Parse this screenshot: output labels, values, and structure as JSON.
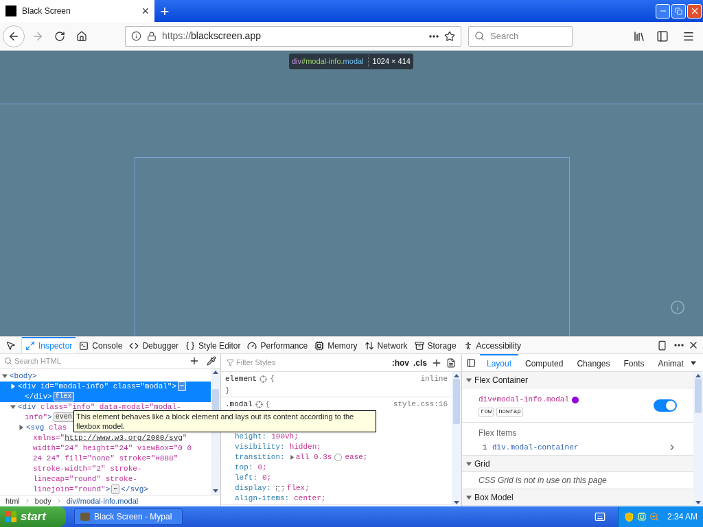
{
  "browser": {
    "tab": {
      "title": "Black Screen",
      "close": "×"
    },
    "new_tab": "+",
    "back_disabled": false,
    "forward_disabled": true,
    "url": {
      "scheme": "https://",
      "host": "blackscreen.app"
    },
    "search": {
      "placeholder": "Search"
    }
  },
  "page": {
    "highlight_label": {
      "tag": "div",
      "id": "#modal-info",
      "cls": ".modal",
      "size": "1024 × 414"
    }
  },
  "devtools": {
    "tabs": [
      {
        "label": "Inspector",
        "selected": true
      },
      {
        "label": "Console",
        "selected": false
      },
      {
        "label": "Debugger",
        "selected": false
      },
      {
        "label": "Style Editor",
        "selected": false
      },
      {
        "label": "Performance",
        "selected": false
      },
      {
        "label": "Memory",
        "selected": false
      },
      {
        "label": "Network",
        "selected": false
      },
      {
        "label": "Storage",
        "selected": false
      },
      {
        "label": "Accessibility",
        "selected": false
      }
    ],
    "markup": {
      "search_placeholder": "Search HTML",
      "nodes": [
        {
          "expanded": true,
          "selected": false,
          "lines": [
            [
              {
                "kind": "tag",
                "text": "<body>"
              }
            ]
          ],
          "children": [
            {
              "expanded": false,
              "selected": true,
              "lines": [
                [
                  {
                    "kind": "tag",
                    "text": "<div "
                  },
                  {
                    "kind": "attr",
                    "text": "id="
                  },
                  {
                    "kind": "val",
                    "text": "\"modal-info\" "
                  },
                  {
                    "kind": "attr",
                    "text": "class="
                  },
                  {
                    "kind": "val",
                    "text": "\"modal\""
                  },
                  {
                    "kind": "tag",
                    "text": ">"
                  },
                  {
                    "kind": "badge",
                    "text": "⋯"
                  }
                ],
                [
                  {
                    "kind": "tag",
                    "text": "</div>"
                  },
                  {
                    "kind": "badge",
                    "text": "flex"
                  }
                ]
              ]
            },
            {
              "expanded": true,
              "selected": false,
              "lines": [
                [
                  {
                    "kind": "tag",
                    "text": "<div "
                  },
                  {
                    "kind": "attr",
                    "text": "class="
                  },
                  {
                    "kind": "val",
                    "text": "\"info\" "
                  },
                  {
                    "kind": "attr",
                    "text": "data-modal="
                  },
                  {
                    "kind": "val",
                    "text": "\"modal-"
                  }
                ],
                [
                  {
                    "kind": "val",
                    "text": "info\""
                  },
                  {
                    "kind": "tag",
                    "text": ">"
                  },
                  {
                    "kind": "badge",
                    "text": "even"
                  }
                ]
              ],
              "children": [
                {
                  "expanded": false,
                  "selected": false,
                  "lines": [
                    [
                      {
                        "kind": "tag",
                        "text": "<svg "
                      },
                      {
                        "kind": "attr",
                        "text": "clas"
                      }
                    ],
                    [
                      {
                        "kind": "attr",
                        "text": "xmlns="
                      },
                      {
                        "kind": "val",
                        "text": "\""
                      },
                      {
                        "kind": "link",
                        "text": "http://www.w3.org/2000/svg"
                      },
                      {
                        "kind": "val",
                        "text": "\""
                      }
                    ],
                    [
                      {
                        "kind": "attr",
                        "text": "width="
                      },
                      {
                        "kind": "val",
                        "text": "\"24\" "
                      },
                      {
                        "kind": "attr",
                        "text": "height="
                      },
                      {
                        "kind": "val",
                        "text": "\"24\" "
                      },
                      {
                        "kind": "attr",
                        "text": "viewBox="
                      },
                      {
                        "kind": "val",
                        "text": "\"0 0"
                      }
                    ],
                    [
                      {
                        "kind": "val",
                        "text": "24 24\" "
                      },
                      {
                        "kind": "attr",
                        "text": "fill="
                      },
                      {
                        "kind": "val",
                        "text": "\"none\" "
                      },
                      {
                        "kind": "attr",
                        "text": "stroke="
                      },
                      {
                        "kind": "val",
                        "text": "\"#888\""
                      }
                    ],
                    [
                      {
                        "kind": "attr",
                        "text": "stroke-width="
                      },
                      {
                        "kind": "val",
                        "text": "\"2\" "
                      },
                      {
                        "kind": "attr",
                        "text": "stroke-"
                      }
                    ],
                    [
                      {
                        "kind": "attr",
                        "text": "linecap="
                      },
                      {
                        "kind": "val",
                        "text": "\"round\" "
                      },
                      {
                        "kind": "attr",
                        "text": "stroke-"
                      }
                    ],
                    [
                      {
                        "kind": "attr",
                        "text": "linejoin="
                      },
                      {
                        "kind": "val",
                        "text": "\"round\""
                      },
                      {
                        "kind": "tag",
                        "text": ">"
                      },
                      {
                        "kind": "badge",
                        "text": "⋯"
                      },
                      {
                        "kind": "tag",
                        "text": "</svg>"
                      }
                    ]
                  ]
                }
              ]
            }
          ]
        }
      ],
      "breadcrumbs": [
        {
          "label": "html",
          "selected": false
        },
        {
          "label": "body",
          "selected": false
        },
        {
          "label": "div#modal-info.modal",
          "selected": true
        }
      ],
      "tooltip": "This element behaves like a block element and lays out its content according to the flexbox model."
    },
    "rules": {
      "filter_placeholder": "Filter Styles",
      "hov": ":hov",
      "cls": ".cls",
      "blocks": [
        {
          "selector": "element",
          "open_brace": "{",
          "source": "inline",
          "close_brace": "}"
        },
        {
          "selector": ".modal",
          "open_brace": "{",
          "source": "style.css:16",
          "declarations": [
            {
              "kind": "hidden"
            },
            {
              "kind": "plain",
              "name": "height:",
              "value": "100vh;"
            },
            {
              "kind": "plain",
              "name": "visibility:",
              "value": "hidden;"
            },
            {
              "kind": "transition",
              "name": "transition:",
              "value": "all 0.3s",
              "value2": "ease;"
            },
            {
              "kind": "plain",
              "name": "top:",
              "value": "0;"
            },
            {
              "kind": "plain",
              "name": "left:",
              "value": "0;"
            },
            {
              "kind": "flex",
              "name": "display:",
              "value": "flex;"
            },
            {
              "kind": "plain",
              "name": "align-items:",
              "value": "center;"
            }
          ]
        }
      ]
    },
    "layout": {
      "tabs": [
        {
          "label": "Layout",
          "selected": true
        },
        {
          "label": "Computed",
          "selected": false
        },
        {
          "label": "Changes",
          "selected": false
        },
        {
          "label": "Fonts",
          "selected": false
        },
        {
          "label": "Animat",
          "selected": false
        }
      ],
      "flex_container": {
        "title": "Flex Container",
        "expanded": true,
        "selector": "div#modal-info.modal",
        "color": "#9400e0",
        "tags": [
          "row",
          "nowrap"
        ],
        "on": true,
        "items_title": "Flex Items",
        "items": [
          {
            "index": "1",
            "name": "div.modal-container"
          }
        ]
      },
      "grid": {
        "title": "Grid",
        "expanded": true,
        "message": "CSS Grid is not in use on this page"
      },
      "box_model": {
        "title": "Box Model",
        "expanded": true
      }
    }
  },
  "taskbar": {
    "start": "start",
    "task": "Black Screen - Mypal",
    "clock": "2:34 AM"
  }
}
